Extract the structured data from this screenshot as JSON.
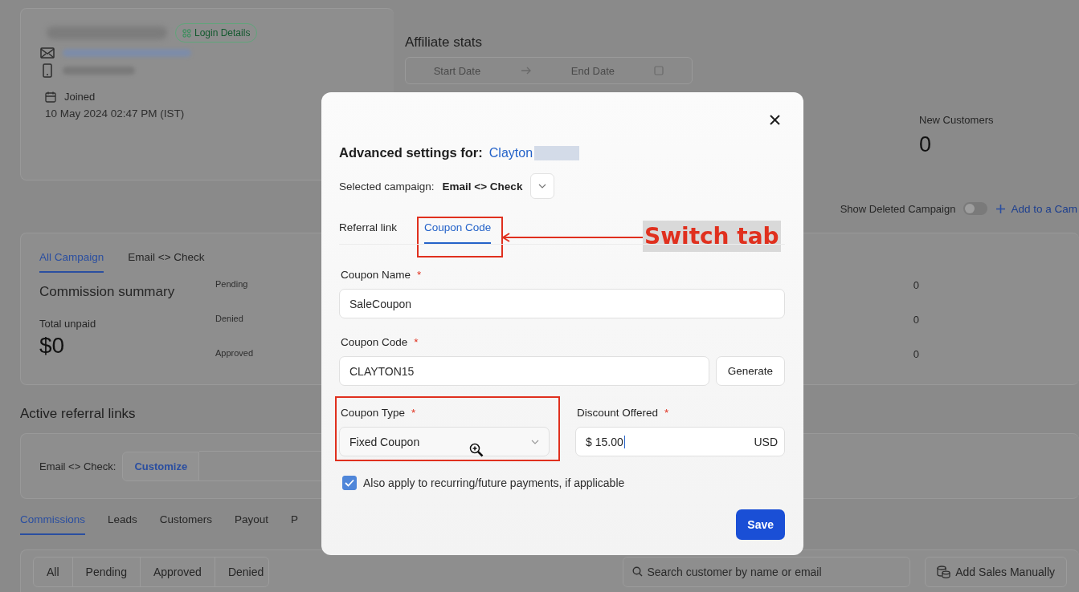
{
  "profile": {
    "login_details": "Login Details",
    "joined_label": "Joined",
    "joined_date": "10 May 2024 02:47 PM (IST)"
  },
  "affiliate_stats": {
    "title": "Affiliate stats",
    "start_placeholder": "Start Date",
    "end_placeholder": "End Date",
    "stats": [
      {
        "label": "New Customers",
        "value": "0"
      }
    ]
  },
  "campaign_bar": {
    "toggle_label": "Show Deleted Campaign",
    "toggle_on": false,
    "add_link": "Add to a Cam"
  },
  "campaign_tabs": [
    {
      "label": "All Campaign",
      "selected": true
    },
    {
      "label": "Email <> Check",
      "selected": false
    }
  ],
  "commission_summary": {
    "title": "Commission summary",
    "total_label": "Total unpaid",
    "total_value": "$0",
    "rows": [
      {
        "label": "Pending",
        "value": "0"
      },
      {
        "label": "Denied",
        "value": "0"
      },
      {
        "label": "Approved",
        "value": "0"
      }
    ]
  },
  "referral_links": {
    "title": "Active referral links",
    "rows": [
      {
        "label": "Email <> Check:",
        "action": "Customize"
      }
    ]
  },
  "section_tabs": [
    {
      "label": "Commissions",
      "selected": true
    },
    {
      "label": "Leads",
      "selected": false
    },
    {
      "label": "Customers",
      "selected": false
    },
    {
      "label": "Payout",
      "selected": false
    },
    {
      "label": "P",
      "selected": false
    }
  ],
  "filters": [
    {
      "label": "All",
      "selected": false
    },
    {
      "label": "Pending",
      "selected": false
    },
    {
      "label": "Approved",
      "selected": false
    },
    {
      "label": "Denied",
      "selected": false
    }
  ],
  "search": {
    "placeholder": "Search customer by name or email"
  },
  "add_sales_button": "Add Sales Manually",
  "modal": {
    "title": "Advanced settings for:",
    "affiliate_name": "Clayton",
    "campaign_label": "Selected campaign:",
    "campaign_value": "Email <> Check",
    "tabs": [
      {
        "label": "Referral link",
        "selected": false
      },
      {
        "label": "Coupon Code",
        "selected": true
      }
    ],
    "coupon_name": {
      "label": "Coupon Name",
      "required_mark": "*",
      "value": "SaleCoupon"
    },
    "coupon_code": {
      "label": "Coupon Code",
      "required_mark": "*",
      "value": "CLAYTON15",
      "button": "Generate"
    },
    "coupon_type": {
      "label": "Coupon Type",
      "required_mark": "*",
      "value": "Fixed Coupon"
    },
    "discount": {
      "label": "Discount Offered",
      "required_mark": "*",
      "value": "$ 15.00",
      "unit": "USD"
    },
    "recurring": {
      "label": "Also apply to recurring/future payments, if applicable",
      "checked": true
    },
    "save_button": "Save"
  },
  "annotation": {
    "label": "Switch tab"
  }
}
